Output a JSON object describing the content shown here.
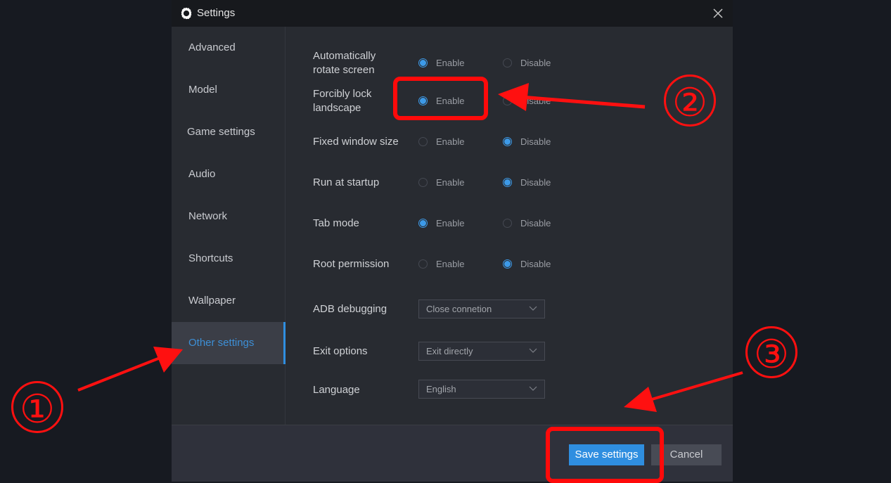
{
  "window": {
    "title": "Settings",
    "title_icon": "gear-icon",
    "close_icon": "close-icon"
  },
  "sidebar": {
    "items": [
      {
        "label": "Advanced",
        "active": false
      },
      {
        "label": "Model",
        "active": false
      },
      {
        "label": "Game settings",
        "active": false
      },
      {
        "label": "Audio",
        "active": false
      },
      {
        "label": "Network",
        "active": false
      },
      {
        "label": "Shortcuts",
        "active": false
      },
      {
        "label": "Wallpaper",
        "active": false
      },
      {
        "label": "Other settings",
        "active": true
      }
    ]
  },
  "settings": {
    "radio_rows": [
      {
        "label_line1": "Automatically",
        "label_line2": "rotate screen",
        "enable": "Enable",
        "disable": "Disable",
        "selected": "Enable"
      },
      {
        "label_line1": "Forcibly lock",
        "label_line2": "landscape",
        "enable": "Enable",
        "disable": "Disable",
        "selected": "Enable"
      },
      {
        "label": "Fixed window size",
        "enable": "Enable",
        "disable": "Disable",
        "selected": "Disable"
      },
      {
        "label": "Run at startup",
        "enable": "Enable",
        "disable": "Disable",
        "selected": "Disable"
      },
      {
        "label": "Tab mode",
        "enable": "Enable",
        "disable": "Disable",
        "selected": "Enable"
      },
      {
        "label": "Root permission",
        "enable": "Enable",
        "disable": "Disable",
        "selected": "Disable"
      }
    ],
    "dropdowns": [
      {
        "label": "ADB debugging",
        "value": "Close connetion"
      },
      {
        "label": "Exit options",
        "value": "Exit directly"
      },
      {
        "label": "Language",
        "value": "English"
      }
    ]
  },
  "footer": {
    "save_label": "Save settings",
    "cancel_label": "Cancel"
  },
  "annotations": {
    "step1": "①",
    "step2": "②",
    "step3": "③",
    "color": "#ff1010"
  },
  "colors": {
    "accent": "#2f8ee0",
    "background": "#282b31",
    "titlebar": "#17191d"
  }
}
